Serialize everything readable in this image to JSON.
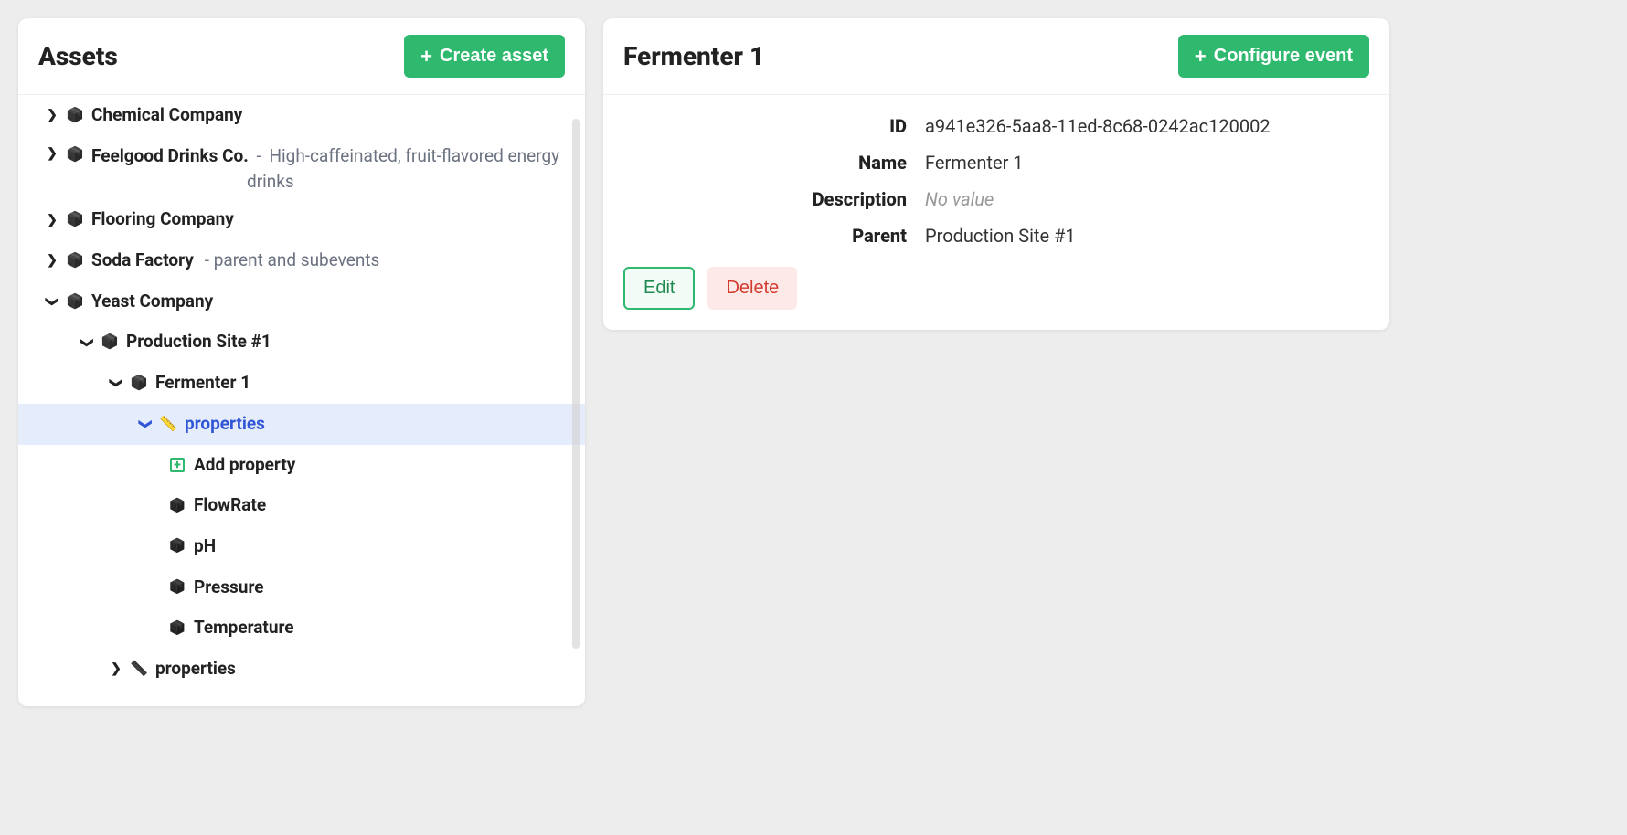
{
  "left": {
    "title": "Assets",
    "create_label": "Create asset",
    "tree": {
      "chemical": {
        "label": "Chemical Company"
      },
      "feelgood": {
        "label": "Feelgood Drinks Co.",
        "desc_prefix": " - ",
        "desc1": "High-caffeinated, fruit-flavored energy",
        "desc2": "drinks"
      },
      "flooring": {
        "label": "Flooring Company"
      },
      "soda": {
        "label": "Soda Factory",
        "desc": " - parent and subevents"
      },
      "yeast": {
        "label": "Yeast Company"
      },
      "prodsite": {
        "label": "Production Site #1"
      },
      "fermenter": {
        "label": "Fermenter 1"
      },
      "properties_sel": {
        "label": "properties"
      },
      "add_property": {
        "label": "Add property"
      },
      "flowrate": {
        "label": "FlowRate"
      },
      "ph": {
        "label": "pH"
      },
      "pressure": {
        "label": "Pressure"
      },
      "temperature": {
        "label": "Temperature"
      },
      "properties2": {
        "label": "properties"
      }
    }
  },
  "right": {
    "title": "Fermenter 1",
    "configure_label": "Configure event",
    "id_key": "ID",
    "id_val": "a941e326-5aa8-11ed-8c68-0242ac120002",
    "name_key": "Name",
    "name_val": "Fermenter 1",
    "desc_key": "Description",
    "desc_val": "No value",
    "parent_key": "Parent",
    "parent_val": "Production Site #1",
    "edit_label": "Edit",
    "delete_label": "Delete"
  }
}
